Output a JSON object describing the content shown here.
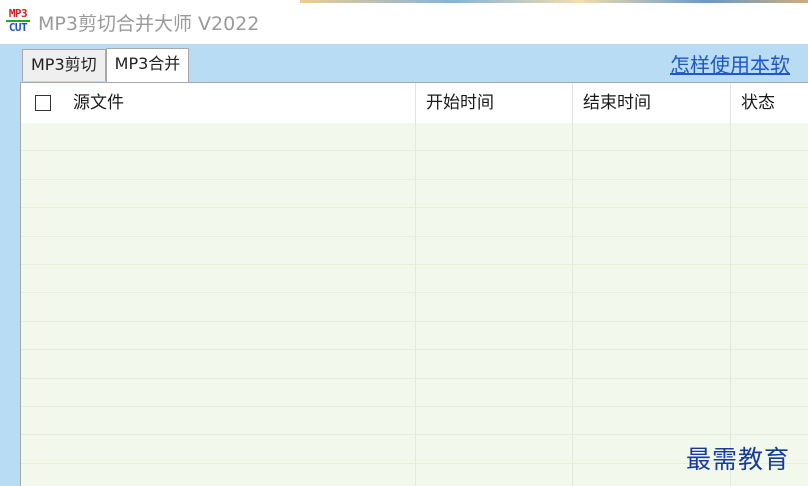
{
  "window": {
    "title": "MP3剪切合并大师 V2022",
    "logo_top": "MP3",
    "logo_bottom": "CUT"
  },
  "tabs": [
    {
      "label": "MP3剪切",
      "active": false
    },
    {
      "label": "MP3合并",
      "active": true
    }
  ],
  "help_link": "怎样使用本软",
  "table": {
    "columns": [
      "源文件",
      "开始时间",
      "结束时间",
      "状态"
    ],
    "select_all_checked": false,
    "rows": []
  },
  "watermark": "最需教育",
  "colors": {
    "link": "#1f57c8",
    "row_background": "#f2f8ec",
    "window_background": "#b9dcf5"
  }
}
